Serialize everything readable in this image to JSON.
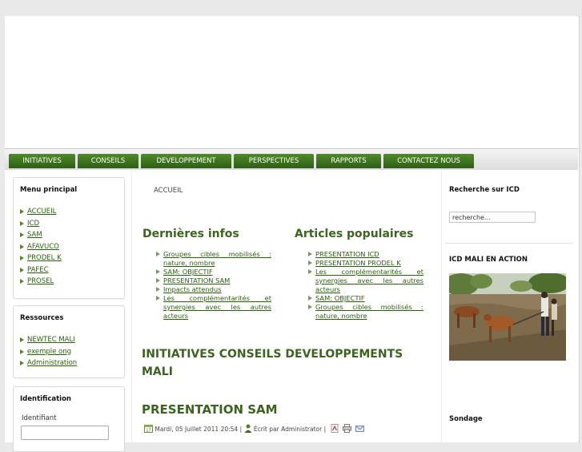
{
  "nav": {
    "tabs": [
      "INITIATIVES",
      "CONSEILS",
      "DEVELOPPEMENT",
      "PERSPECTIVES",
      "RAPPORTS",
      "CONTACTEZ NOUS"
    ]
  },
  "left": {
    "menu_title": "Menu principal",
    "menu_items": [
      "ACCUEIL",
      "ICD",
      "SAM",
      "AFAVUCO",
      "PRODEL K",
      "PAFEC",
      "PROSEL"
    ],
    "resources_title": "Ressources",
    "resources_items": [
      "NEWTEC MALI",
      "exemple ong",
      "Administration"
    ],
    "login_title": "Identification",
    "login_label": "Identifiant"
  },
  "main": {
    "breadcrumb": "ACCUEIL",
    "latest_title": "Dernières infos",
    "latest_items": [
      "Groupes cibles mobilisés : nature, nombre",
      "SAM: OBJECTIF",
      "PRESENTATION SAM",
      "Impacts attendus",
      "Les complémentarités et synergies avec les autres acteurs"
    ],
    "popular_title": "Articles populaires",
    "popular_items": [
      "PRESENTATION ICD",
      "PRESENTATION PRODEL K",
      "Les complémentarités et synergies avec les autres acteurs",
      "SAM: OBJECTIF",
      "Groupes cibles mobilisés : nature, nombre"
    ],
    "section_title": "INITIATIVES CONSEILS DEVELOPPEMENTS MALI",
    "article_title": "PRESENTATION SAM",
    "meta_date": "Mardi, 05 Juillet 2011 20:54",
    "meta_sep": "|",
    "meta_author": "Écrit par Administrator",
    "meta_sep2": "|"
  },
  "right": {
    "search_title": "Recherche sur ICD",
    "search_value": "recherche...",
    "action_title": "ICD MALI EN ACTION",
    "poll_title": "Sondage"
  },
  "colors": {
    "nav_green": "#3d7420",
    "link_green": "#2b5e0f",
    "heading_green": "#3c6320"
  },
  "icons": [
    "calendar-icon",
    "author-icon",
    "pdf-icon",
    "print-icon",
    "email-icon",
    "arrow-bullet-icon"
  ]
}
